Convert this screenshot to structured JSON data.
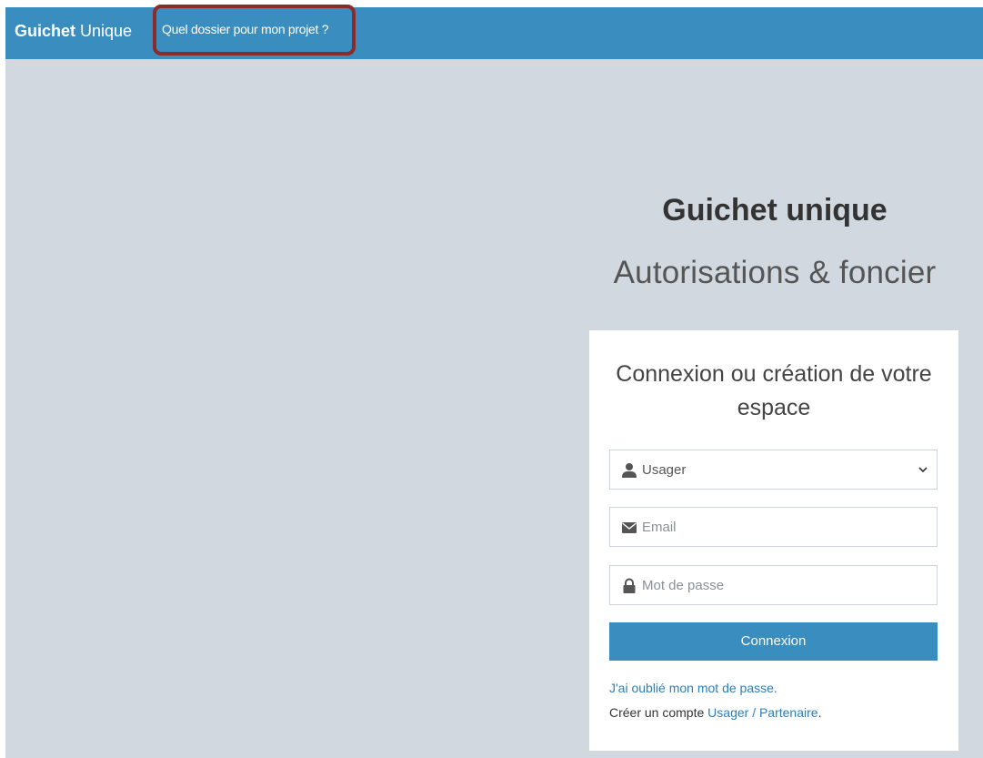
{
  "navbar": {
    "brand_bold": "Guichet",
    "brand_regular": "Unique",
    "link_label": "Quel dossier pour mon projet ?"
  },
  "hero": {
    "title": "Guichet unique",
    "subtitle": "Autorisations & foncier"
  },
  "login": {
    "title": "Connexion ou création de votre espace",
    "role_select": {
      "value": "Usager",
      "icon": "user-icon"
    },
    "email_field": {
      "placeholder": "Email",
      "icon": "envelope-icon"
    },
    "password_field": {
      "placeholder": "Mot de passe",
      "icon": "lock-icon"
    },
    "submit_label": "Connexion",
    "forgot_label": "J'ai oublié mon mot de passe.",
    "create_prefix": "Créer un compte ",
    "create_link": "Usager / Partenaire",
    "create_suffix": "."
  },
  "colors": {
    "navbar": "#3a8ebf",
    "page_background": "#d2d8e0",
    "button": "#3a8ebf",
    "link": "#2a7fbd",
    "highlight_outline": "#8b2b2b"
  }
}
